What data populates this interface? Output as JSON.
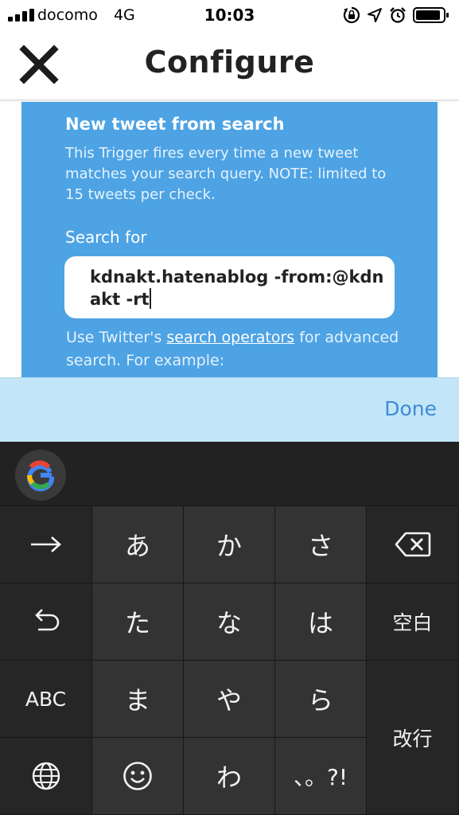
{
  "status_bar": {
    "carrier": "docomo",
    "network": "4G",
    "time": "10:03"
  },
  "nav": {
    "title": "Configure",
    "close_icon": "close-icon"
  },
  "trigger": {
    "title": "New tweet from search",
    "description": "This Trigger fires every time a new tweet matches your search query. NOTE: limited to 15 tweets per check.",
    "search_label": "Search for",
    "search_value": "kdnakt.hatenablog -from:@kdnakt -rt",
    "help_prefix": "Use Twitter's ",
    "help_link": "search operators",
    "help_suffix": " for advanced search. For example:"
  },
  "accessory": {
    "done_label": "Done"
  },
  "keyboard": {
    "keys": {
      "a": "あ",
      "ka": "か",
      "sa": "さ",
      "ta": "た",
      "na": "な",
      "ha": "は",
      "ma": "ま",
      "ya": "や",
      "ra": "ら",
      "wa": "わ",
      "punct": "、。?!",
      "space": "空白",
      "abc": "ABC",
      "enter": "改行"
    },
    "icons": [
      "google-icon",
      "arrow-right-icon",
      "backspace-icon",
      "undo-icon",
      "globe-icon",
      "emoji-icon"
    ]
  }
}
